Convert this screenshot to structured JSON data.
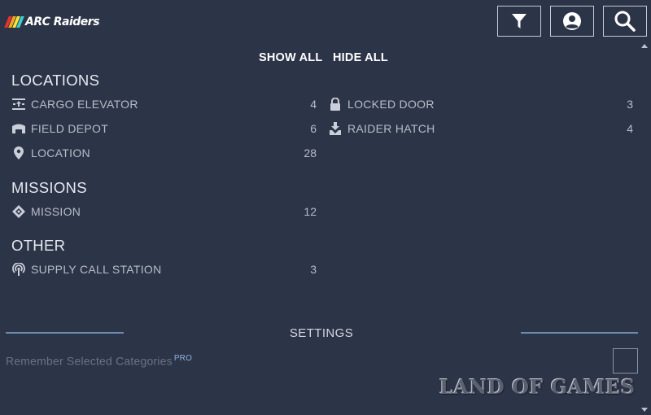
{
  "header": {
    "logo_text": "ARC Raiders",
    "logo_colors": [
      "#e9322f",
      "#f5a623",
      "#f6e33c",
      "#3fd0c9"
    ],
    "buttons": [
      {
        "name": "filter-button",
        "icon": "filter-icon"
      },
      {
        "name": "account-button",
        "icon": "account-icon"
      },
      {
        "name": "search-button",
        "icon": "search-icon"
      }
    ]
  },
  "toggles": {
    "show_all": "SHOW ALL",
    "hide_all": "HIDE ALL"
  },
  "sections": {
    "locations": {
      "title": "LOCATIONS",
      "left": [
        {
          "label": "CARGO ELEVATOR",
          "count": "4",
          "icon": "cargo-elevator-icon"
        },
        {
          "label": "FIELD DEPOT",
          "count": "6",
          "icon": "field-depot-icon"
        },
        {
          "label": "LOCATION",
          "count": "28",
          "icon": "location-pin-icon"
        }
      ],
      "right": [
        {
          "label": "LOCKED DOOR",
          "count": "3",
          "icon": "lock-icon"
        },
        {
          "label": "RAIDER HATCH",
          "count": "4",
          "icon": "raider-hatch-icon"
        }
      ]
    },
    "missions": {
      "title": "MISSIONS",
      "left": [
        {
          "label": "MISSION",
          "count": "12",
          "icon": "mission-icon"
        }
      ]
    },
    "other": {
      "title": "OTHER",
      "left": [
        {
          "label": "SUPPLY CALL STATION",
          "count": "3",
          "icon": "supply-call-station-icon"
        }
      ]
    }
  },
  "settings": {
    "title": "SETTINGS",
    "remember_label": "Remember Selected Categories",
    "pro_badge": "PRO",
    "remember_checked": false
  },
  "watermark": "LAND OF GAMES",
  "colors": {
    "background": "#2c3447",
    "accent_rule": "#6f8ab0",
    "pro": "#8fb2e0"
  }
}
